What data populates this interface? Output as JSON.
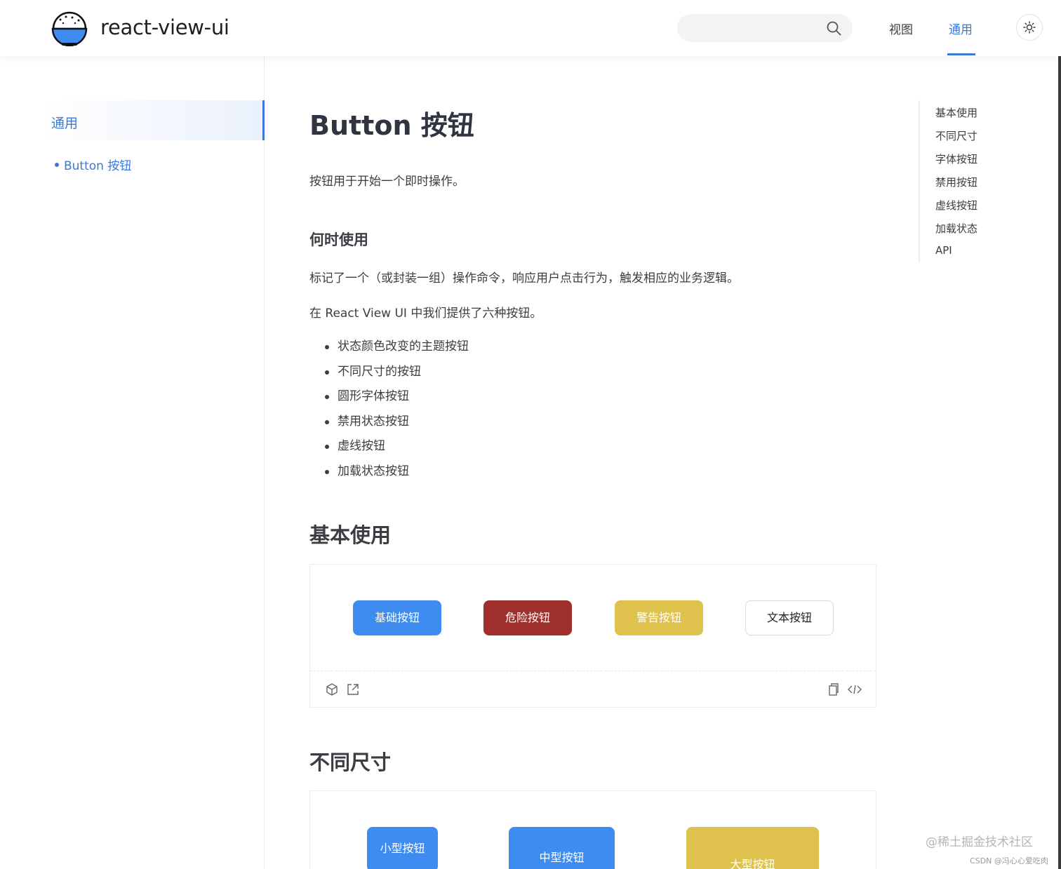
{
  "header": {
    "site_title": "react-view-ui",
    "search": {
      "placeholder": ""
    },
    "nav": [
      {
        "label": "视图"
      },
      {
        "label": "通用",
        "active": true
      }
    ]
  },
  "sidebar": {
    "group_label": "通用",
    "items": [
      {
        "label": "Button 按钮",
        "active": true
      }
    ]
  },
  "content": {
    "title": "Button 按钮",
    "intro": "按钮用于开始一个即时操作。",
    "when_heading": "何时使用",
    "when_text": "标记了一个（或封装一组）操作命令，响应用户点击行为，触发相应的业务逻辑。",
    "provide_text": "在 React View UI 中我们提供了六种按钮。",
    "features": [
      "状态颜色改变的主题按钮",
      "不同尺寸的按钮",
      "圆形字体按钮",
      "禁用状态按钮",
      "虚线按钮",
      "加载状态按钮"
    ],
    "basic_heading": "基本使用",
    "basic_buttons": [
      "基础按钮",
      "危险按钮",
      "警告按钮",
      "文本按钮"
    ],
    "size_heading": "不同尺寸",
    "size_buttons": [
      "小型按钮",
      "中型按钮",
      "大型按钮"
    ]
  },
  "toc": [
    "基本使用",
    "不同尺寸",
    "字体按钮",
    "禁用按钮",
    "虚线按钮",
    "加载状态",
    "API"
  ],
  "watermark": "@稀土掘金技术社区",
  "csdn_mark": "CSDN @冯心心爱吃肉",
  "colors": {
    "accent": "#3c78d8",
    "primary_button": "#3f8cf0",
    "danger_button": "#9e2f2b",
    "warning_button": "#dfc24e"
  }
}
